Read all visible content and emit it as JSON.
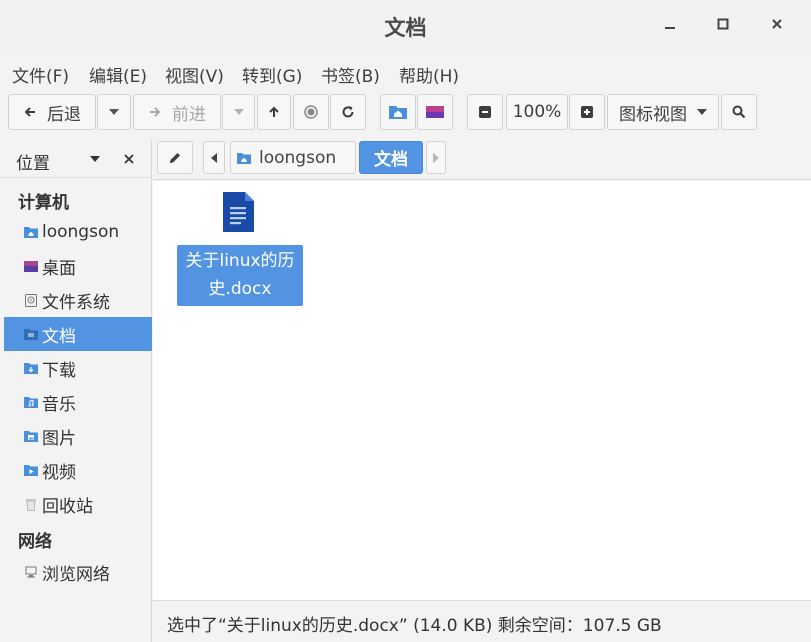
{
  "window": {
    "title": "文档"
  },
  "menubar": {
    "items": [
      "文件(F)",
      "编辑(E)",
      "视图(V)",
      "转到(G)",
      "书签(B)",
      "帮助(H)"
    ]
  },
  "toolbar": {
    "back_label": "后退",
    "forward_label": "前进",
    "zoom_label": "100%",
    "view_mode_label": "图标视图"
  },
  "sidebar": {
    "header": "位置",
    "sections": [
      {
        "title": "计算机",
        "items": [
          {
            "label": "loongson",
            "icon": "home-folder-icon"
          },
          {
            "label": "桌面",
            "icon": "desktop-icon"
          },
          {
            "label": "文件系统",
            "icon": "drive-icon"
          },
          {
            "label": "文档",
            "icon": "documents-folder-icon",
            "selected": true
          },
          {
            "label": "下载",
            "icon": "downloads-folder-icon"
          },
          {
            "label": "音乐",
            "icon": "music-folder-icon"
          },
          {
            "label": "图片",
            "icon": "pictures-folder-icon"
          },
          {
            "label": "视频",
            "icon": "videos-folder-icon"
          },
          {
            "label": "回收站",
            "icon": "trash-icon"
          }
        ]
      },
      {
        "title": "网络",
        "items": [
          {
            "label": "浏览网络",
            "icon": "network-icon"
          }
        ]
      }
    ]
  },
  "pathbar": {
    "crumbs": [
      {
        "label": "loongson",
        "icon": "home-folder-icon"
      },
      {
        "label": "文档",
        "selected": true
      }
    ]
  },
  "content": {
    "files": [
      {
        "name_line1": "关于linux的历",
        "name_line2": "史.docx",
        "icon": "word-document-icon",
        "selected": true
      }
    ]
  },
  "statusbar": {
    "text": "选中了“关于linux的历史.docx” (14.0 KB) 剩余空间：107.5 GB"
  },
  "colors": {
    "accent": "#5294e2",
    "folder": "#4a90d9"
  }
}
